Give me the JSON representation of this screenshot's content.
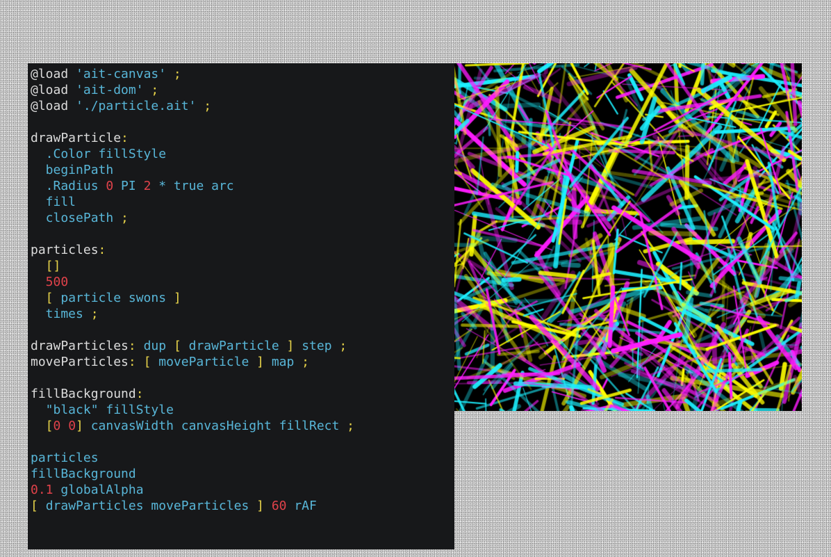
{
  "editor": {
    "lines": [
      [
        {
          "t": "@load ",
          "c": "def"
        },
        {
          "t": "'ait-canvas'",
          "c": "kw"
        },
        {
          "t": " ;",
          "c": "pun"
        }
      ],
      [
        {
          "t": "@load ",
          "c": "def"
        },
        {
          "t": "'ait-dom'",
          "c": "kw"
        },
        {
          "t": " ;",
          "c": "pun"
        }
      ],
      [
        {
          "t": "@load ",
          "c": "def"
        },
        {
          "t": "'./particle.ait'",
          "c": "kw"
        },
        {
          "t": " ;",
          "c": "pun"
        }
      ],
      [],
      [
        {
          "t": "drawParticle",
          "c": "def"
        },
        {
          "t": ":",
          "c": "pun"
        }
      ],
      [
        {
          "t": "  .Color fillStyle",
          "c": "kw"
        }
      ],
      [
        {
          "t": "  beginPath",
          "c": "kw"
        }
      ],
      [
        {
          "t": "  .Radius ",
          "c": "kw"
        },
        {
          "t": "0",
          "c": "num"
        },
        {
          "t": " PI ",
          "c": "kw"
        },
        {
          "t": "2",
          "c": "num"
        },
        {
          "t": " * true arc",
          "c": "kw"
        }
      ],
      [
        {
          "t": "  fill",
          "c": "kw"
        }
      ],
      [
        {
          "t": "  closePath",
          "c": "kw"
        },
        {
          "t": " ;",
          "c": "pun"
        }
      ],
      [],
      [
        {
          "t": "particles",
          "c": "def"
        },
        {
          "t": ":",
          "c": "pun"
        }
      ],
      [
        {
          "t": "  []",
          "c": "pun"
        }
      ],
      [
        {
          "t": "  500",
          "c": "num"
        }
      ],
      [
        {
          "t": "  [",
          "c": "pun"
        },
        {
          "t": " particle swons ",
          "c": "kw"
        },
        {
          "t": "]",
          "c": "pun"
        }
      ],
      [
        {
          "t": "  times",
          "c": "kw"
        },
        {
          "t": " ;",
          "c": "pun"
        }
      ],
      [],
      [
        {
          "t": "drawParticles",
          "c": "def"
        },
        {
          "t": ": ",
          "c": "pun"
        },
        {
          "t": "dup ",
          "c": "kw"
        },
        {
          "t": "[ ",
          "c": "pun"
        },
        {
          "t": "drawParticle ",
          "c": "kw"
        },
        {
          "t": "] ",
          "c": "pun"
        },
        {
          "t": "step",
          "c": "kw"
        },
        {
          "t": " ;",
          "c": "pun"
        }
      ],
      [
        {
          "t": "moveParticles",
          "c": "def"
        },
        {
          "t": ": [ ",
          "c": "pun"
        },
        {
          "t": "moveParticle ",
          "c": "kw"
        },
        {
          "t": "] ",
          "c": "pun"
        },
        {
          "t": "map",
          "c": "kw"
        },
        {
          "t": " ;",
          "c": "pun"
        }
      ],
      [],
      [
        {
          "t": "fillBackground",
          "c": "def"
        },
        {
          "t": ":",
          "c": "pun"
        }
      ],
      [
        {
          "t": "  \"black\" fillStyle",
          "c": "kw"
        }
      ],
      [
        {
          "t": "  [",
          "c": "pun"
        },
        {
          "t": "0 0",
          "c": "num"
        },
        {
          "t": "]",
          "c": "pun"
        },
        {
          "t": " canvasWidth canvasHeight fillRect",
          "c": "kw"
        },
        {
          "t": " ;",
          "c": "pun"
        }
      ],
      [],
      [
        {
          "t": "particles",
          "c": "kw"
        }
      ],
      [
        {
          "t": "fillBackground",
          "c": "kw"
        }
      ],
      [
        {
          "t": "0.1",
          "c": "num"
        },
        {
          "t": " globalAlpha",
          "c": "kw"
        }
      ],
      [
        {
          "t": "[ ",
          "c": "pun"
        },
        {
          "t": "drawParticles moveParticles ",
          "c": "kw"
        },
        {
          "t": "] ",
          "c": "pun"
        },
        {
          "t": "60",
          "c": "num"
        },
        {
          "t": " rAF",
          "c": "kw"
        }
      ]
    ]
  },
  "colors": {
    "editor_bg": "#17181a",
    "identifier": "#58b6d8",
    "number": "#e0424a",
    "punctuation": "#e8d44a",
    "definition": "#dcdcdc",
    "canvas_bg": "#000000",
    "particles": [
      "#ff1cff",
      "#1cf0ff",
      "#ffff00"
    ]
  }
}
